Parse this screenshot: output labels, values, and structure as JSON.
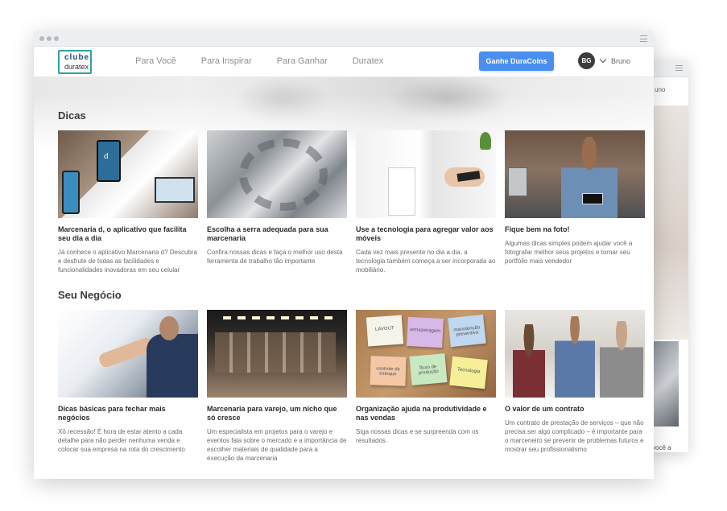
{
  "nav": {
    "logo_top": "clube",
    "logo_bottom": "duratex",
    "links": [
      "Para Você",
      "Para Inspirar",
      "Para Ganhar",
      "Duratex"
    ],
    "cta_label": "Ganhe DuraCoins",
    "user_initials": "BG",
    "user_name": "Bruno"
  },
  "back_window": {
    "name_fragment": "uno",
    "text_fragment": "você a"
  },
  "sections": [
    {
      "title": "Dicas",
      "cards": [
        {
          "title": "Marcenaria d, o aplicativo que facilita seu dia a dia",
          "desc": "Já conhece o aplicativo Marcenaria d? Descubra e desfrute de todas as facilidades e funcionalidades inovadoras em seu celular"
        },
        {
          "title": "Escolha a serra adequada para sua marcenaria",
          "desc": "Confira nossas dicas e faça o melhor uso desta ferramenta de trabalho tão importante"
        },
        {
          "title": "Use a tecnologia para agregar valor aos móveis",
          "desc": "Cada vez mais presente no dia a dia, a tecnologia também começa a ser incorporada ao mobiliário."
        },
        {
          "title": "Fique bem na foto!",
          "desc": "Algumas dicas simples podem ajudar você a fotografar melhor seus projetos e tornar seu portfólio mais vendedor"
        }
      ]
    },
    {
      "title": "Seu Negócio",
      "cards": [
        {
          "title": "Dicas básicas para fechar mais negócios",
          "desc": "Xô recessão! É hora de estar atento a cada detalhe para não perder nenhuma venda e colocar sua empresa na rota do crescimento"
        },
        {
          "title": "Marcenaria para varejo, um nicho que só cresce",
          "desc": "Um especialista em projetos para o varejo e eventos fala sobre o mercado e a importância de escolher materiais de qualidade para a execução da marcenaria"
        },
        {
          "title": "Organização ajuda na produtividade e nas vendas",
          "desc": "Siga nossas dicas e se surpreenda com os resultados."
        },
        {
          "title": "O valor de um contrato",
          "desc": "Um contrato de prestação de serviços – que não precisa ser algo complicado – é importante para o marceneiro se prevenir de problemas futuros e mostrar seu profissionalismo"
        }
      ]
    }
  ],
  "sticky_notes": [
    "LAVOUT",
    "armazenagem",
    "manutenção preventiva",
    "controle de estoque",
    "fluxo de produção",
    "Tecnologia"
  ],
  "icons": {
    "window_dots": "window-controls-icon",
    "window_menu": "hamburger-menu-icon",
    "user_dropdown": "chevron-down-icon"
  },
  "colors": {
    "accent": "#4a8ef0",
    "logo_border": "#2aa5a0",
    "avatar": "#3d3d3d"
  }
}
